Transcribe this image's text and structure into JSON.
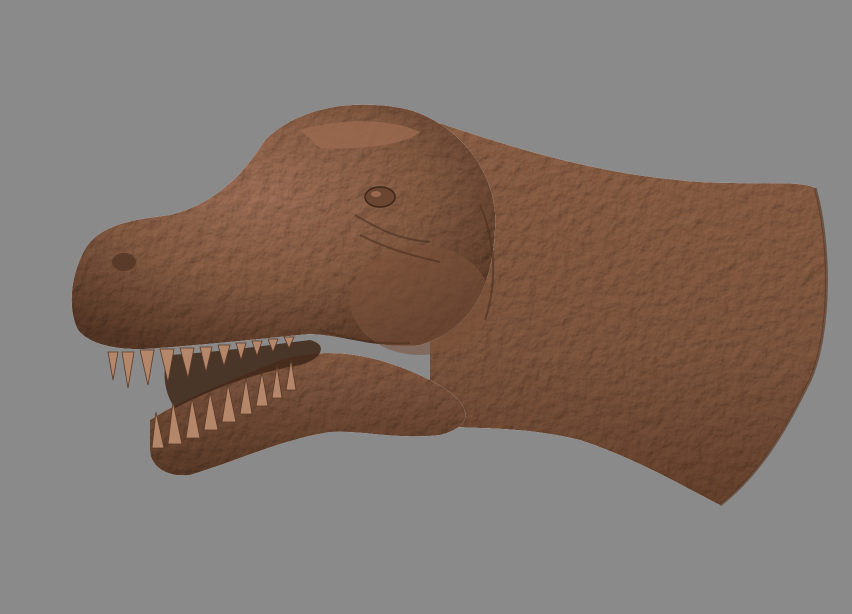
{
  "viewport": {
    "background_color": "#8a8a8a"
  },
  "model": {
    "subject": "dinosaur-head-3d-model",
    "surface_color": "#8a5f45",
    "highlight_color": "#b07e5e",
    "shadow_color": "#4a3021",
    "teeth_color": "#b5876a"
  }
}
